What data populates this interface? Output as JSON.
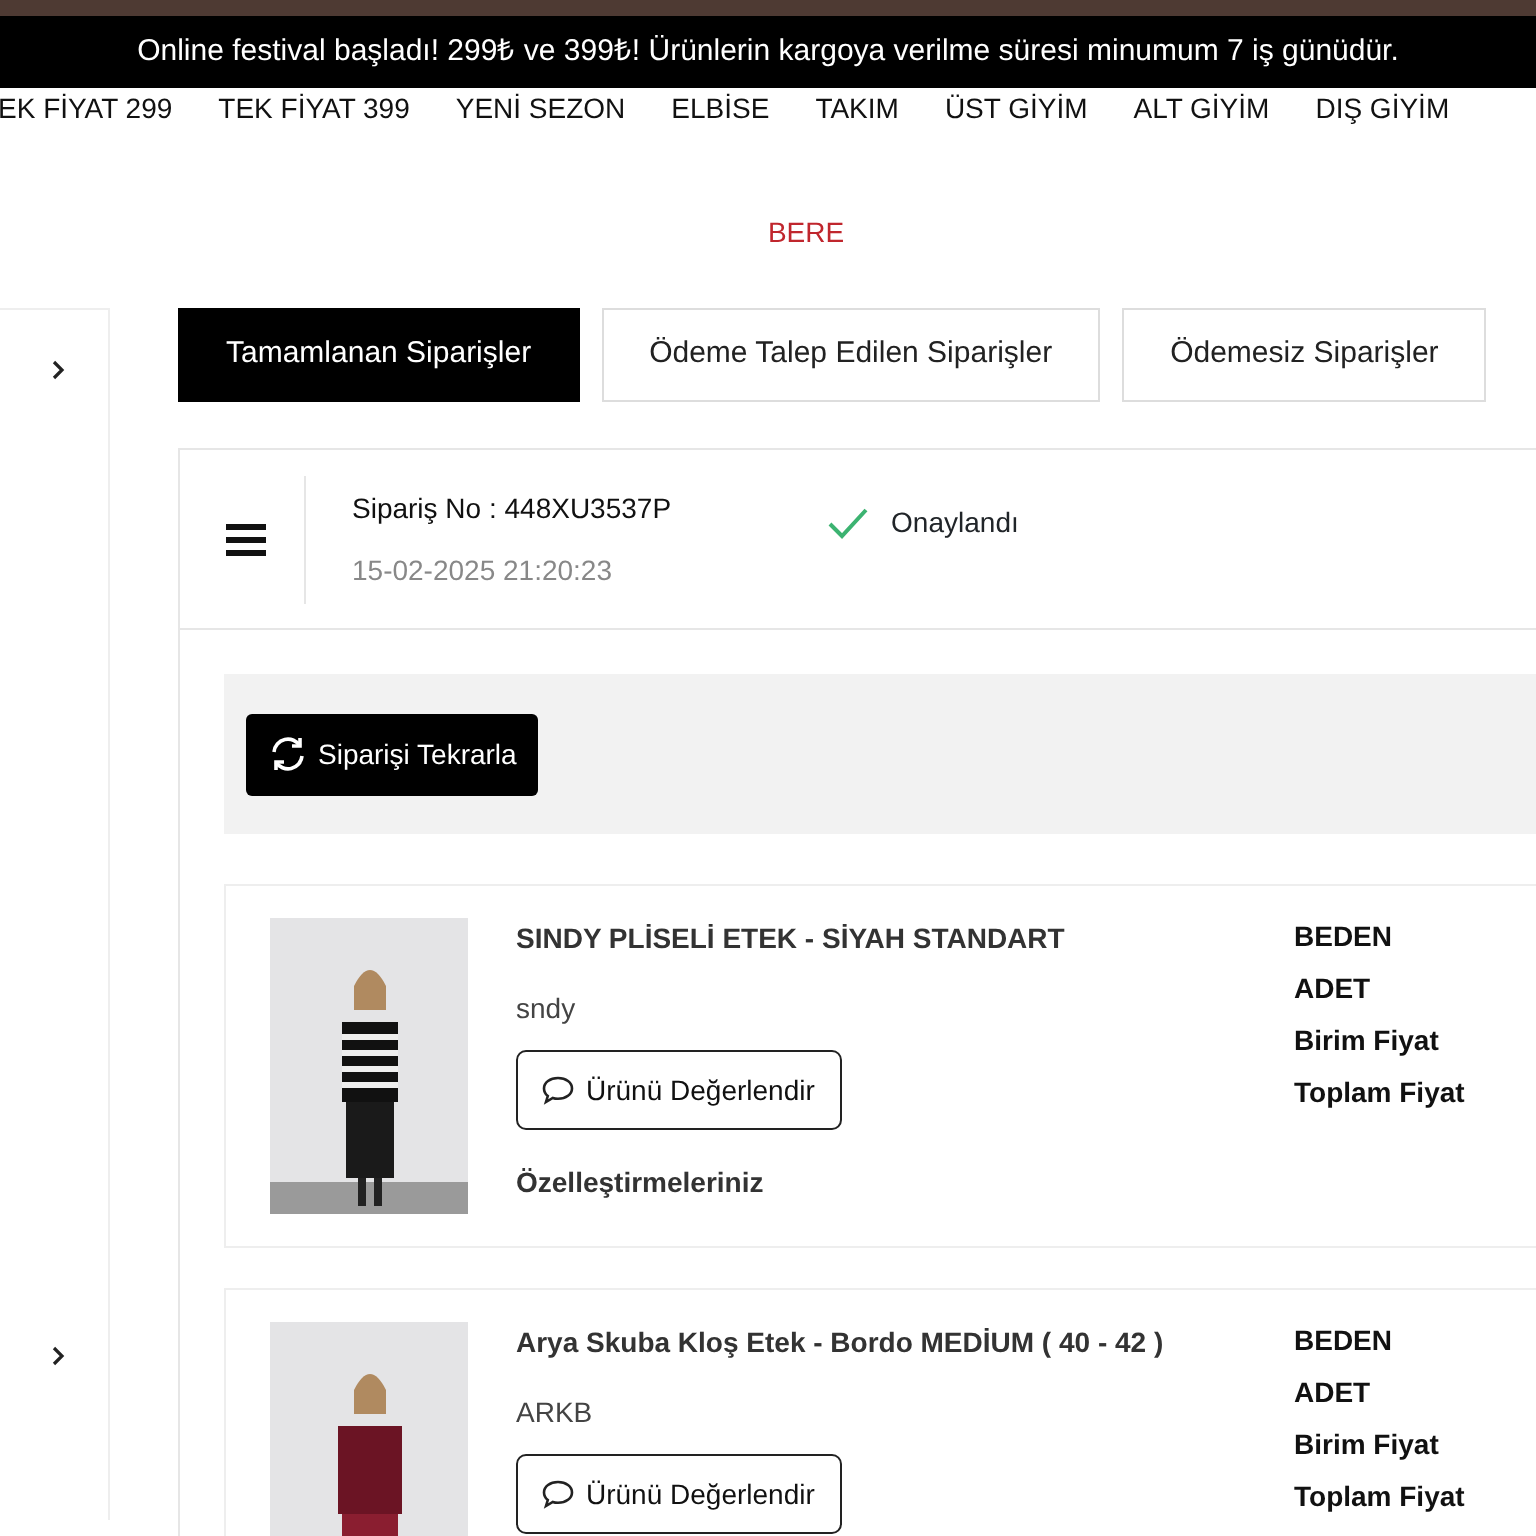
{
  "announcement": "Online festival başladı! 299₺ ve 399₺! Ürünlerin kargoya verilme süresi minumum 7 iş günüdür.",
  "nav_items": [
    "EK FİYAT 299",
    "TEK FİYAT 399",
    "YENİ SEZON",
    "ELBİSE",
    "TAKIM",
    "ÜST GİYİM",
    "ALT GİYİM",
    "DIŞ GİYİM"
  ],
  "sub_nav_items": [
    "BERE"
  ],
  "tabs": [
    {
      "label": "Tamamlanan Siparişler",
      "selected": true
    },
    {
      "label": "Ödeme Talep Edilen Siparişler",
      "selected": false
    },
    {
      "label": "Ödemesiz Siparişler",
      "selected": false
    }
  ],
  "order": {
    "number": "Sipariş No : 448XU3537P",
    "date": "15-02-2025 21:20:23",
    "status": "Onaylandı",
    "repeat_button": "Siparişi Tekrarla"
  },
  "products": [
    {
      "title": "SINDY PLİSELİ ETEK - SİYAH STANDART",
      "code": "sndy",
      "review_button": "Ürünü Değerlendir",
      "customizations": "Özelleştirmeleriniz",
      "labels": [
        "BEDEN",
        "ADET",
        "Birim Fiyat",
        "Toplam Fiyat"
      ]
    },
    {
      "title": "Arya Skuba Kloş Etek - Bordo MEDİUM ( 40 - 42 )",
      "code": "ARKB",
      "review_button": "Ürünü Değerlendir",
      "labels": [
        "BEDEN",
        "ADET",
        "Birim Fiyat",
        "Toplam Fiyat"
      ]
    }
  ]
}
